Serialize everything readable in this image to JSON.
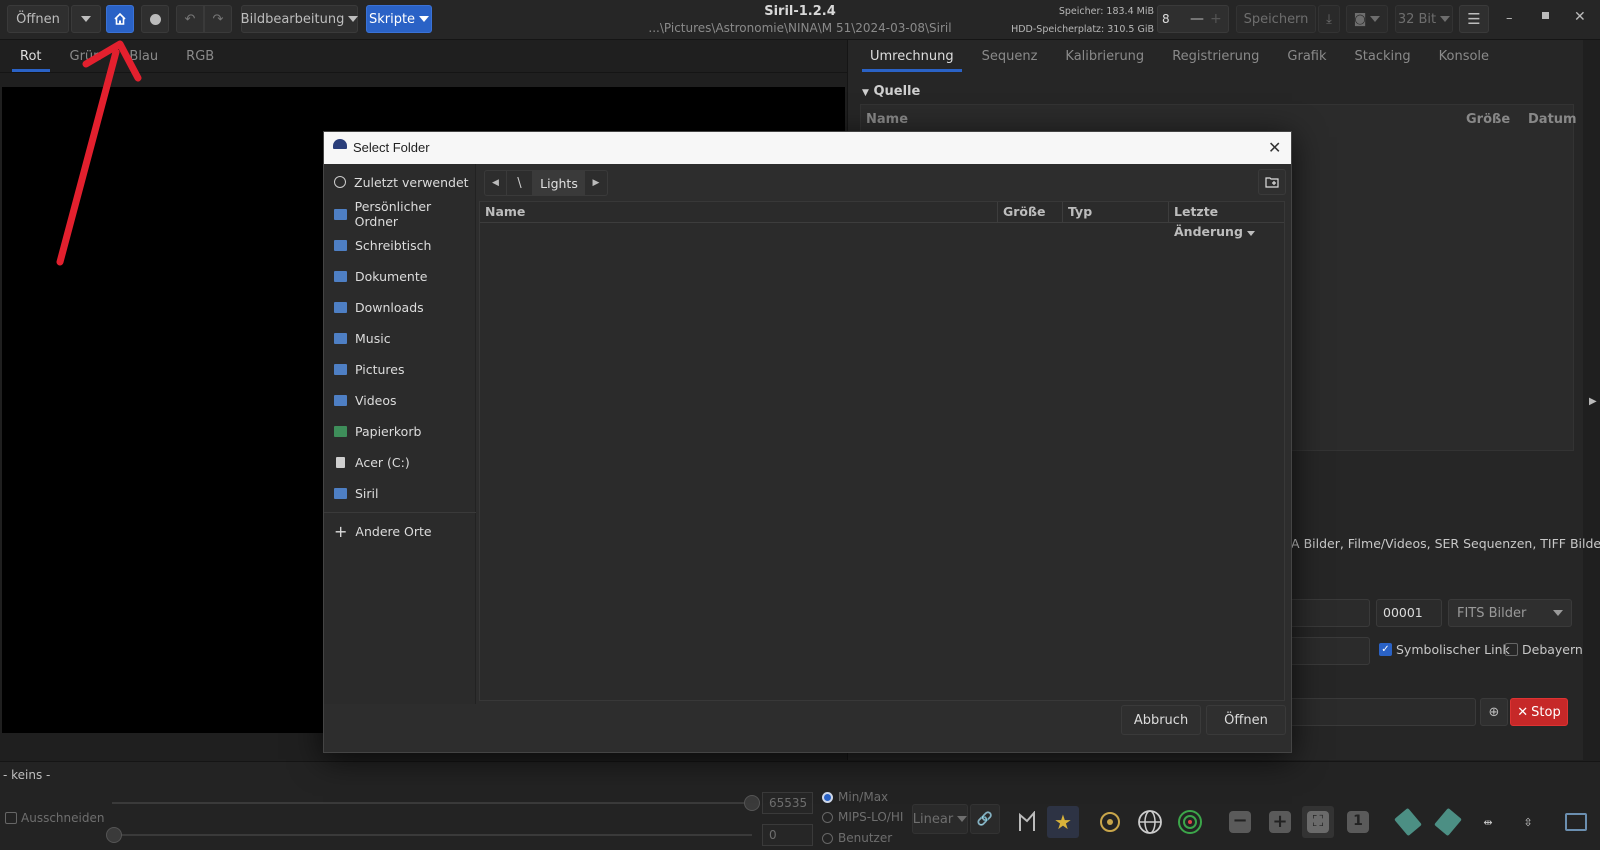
{
  "app": {
    "title": "Siril-1.2.4",
    "path": "...\\Pictures\\Astronomie\\NINA\\M 51\\2024-03-08\\Siril",
    "memory": "Speicher: 183.4 MiB",
    "disk": "HDD-Speicherplatz: 310.5 GiB",
    "threads": "8"
  },
  "header": {
    "open_label": "Öffnen",
    "image_processing_label": "Bildbearbeitung",
    "scripts_label": "Skripte",
    "save_label": "Speichern",
    "bitdepth_label": "32 Bit"
  },
  "left_tabs": [
    "Rot",
    "Grün",
    "Blau",
    "RGB"
  ],
  "right_tabs": [
    "Umrechnung",
    "Sequenz",
    "Kalibrierung",
    "Registrierung",
    "Grafik",
    "Stacking",
    "Konsole"
  ],
  "right_panel": {
    "section_title": "Quelle",
    "col_name": "Name",
    "col_size": "Größe",
    "col_date": "Datum",
    "formats_text": "FA Bilder, Filme/Videos, SER Sequenzen, TIFF Bilder,",
    "index_value": "00001",
    "output_type": "FITS Bilder",
    "symlink_label": "Symbolischer Link",
    "debayer_label": "Debayern",
    "stop_label": "Stop"
  },
  "dialog": {
    "title": "Select Folder",
    "sidebar": [
      {
        "label": "Zuletzt verwendet",
        "icon": "clock-icon"
      },
      {
        "label": "Persönlicher Ordner",
        "icon": "home-folder-icon"
      },
      {
        "label": "Schreibtisch",
        "icon": "desktop-folder-icon"
      },
      {
        "label": "Dokumente",
        "icon": "documents-folder-icon"
      },
      {
        "label": "Downloads",
        "icon": "downloads-folder-icon"
      },
      {
        "label": "Music",
        "icon": "music-folder-icon"
      },
      {
        "label": "Pictures",
        "icon": "pictures-folder-icon"
      },
      {
        "label": "Videos",
        "icon": "videos-folder-icon"
      },
      {
        "label": "Papierkorb",
        "icon": "trash-icon"
      },
      {
        "label": "Acer (C:)",
        "icon": "drive-icon"
      },
      {
        "label": "Siril",
        "icon": "folder-icon"
      }
    ],
    "other_places": "Andere Orte",
    "path_root": "\\",
    "path_current": "Lights",
    "columns": {
      "name": "Name",
      "size": "Größe",
      "type": "Typ",
      "modified": "Letzte Änderung"
    },
    "cancel_label": "Abbruch",
    "open_label": "Öffnen"
  },
  "bottom": {
    "status": "- keins -",
    "crop_label": "Ausschneiden",
    "max_value": "65535",
    "min_value": "0",
    "radio_minmax": "Min/Max",
    "radio_mips": "MIPS-LO/HI",
    "radio_user": "Benutzer",
    "scale_label": "Linear"
  },
  "colors": {
    "accent": "#2a62c6",
    "stop": "#c62828",
    "annotation_arrow": "#e3202e"
  }
}
